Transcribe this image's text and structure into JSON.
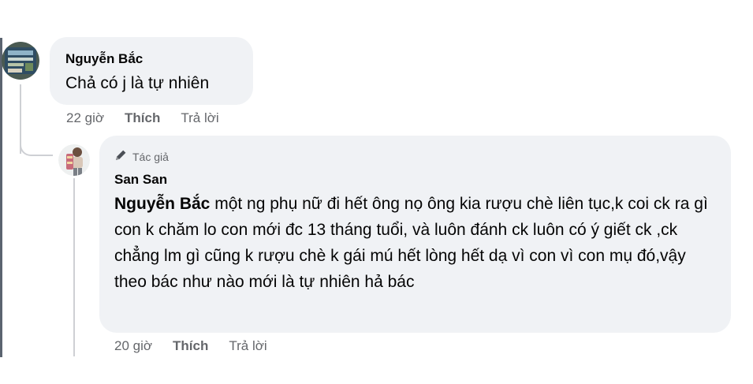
{
  "comment": {
    "author": "Nguyễn Bắc",
    "text": "Chả có j là tự nhiên",
    "time": "22 giờ",
    "like_label": "Thích",
    "reply_label": "Trả lời"
  },
  "reply": {
    "badge": "Tác giả",
    "author": "San San",
    "mention": "Nguyễn Bắc",
    "text": " một ng phụ nữ đi hết ông nọ ông kia rượu chè liên tục,k coi ck ra gì con k chăm lo con mới đc 13 tháng tuổi, và luôn đánh ck luôn có ý giết ck ,ck chẳng lm gì cũng k rượu chè k gái mú hết lòng hết dạ vì con vì con mụ đó,vậy theo bác như nào mới là tự nhiên hả bác",
    "time": "20 giờ",
    "like_label": "Thích",
    "reply_label": "Trả lời"
  },
  "colors": {
    "bubble": "#f0f2f5",
    "meta": "#65676b",
    "text": "#050505",
    "thread_line": "#ced0d4"
  },
  "icons": {
    "author_badge": "pencil-icon"
  }
}
